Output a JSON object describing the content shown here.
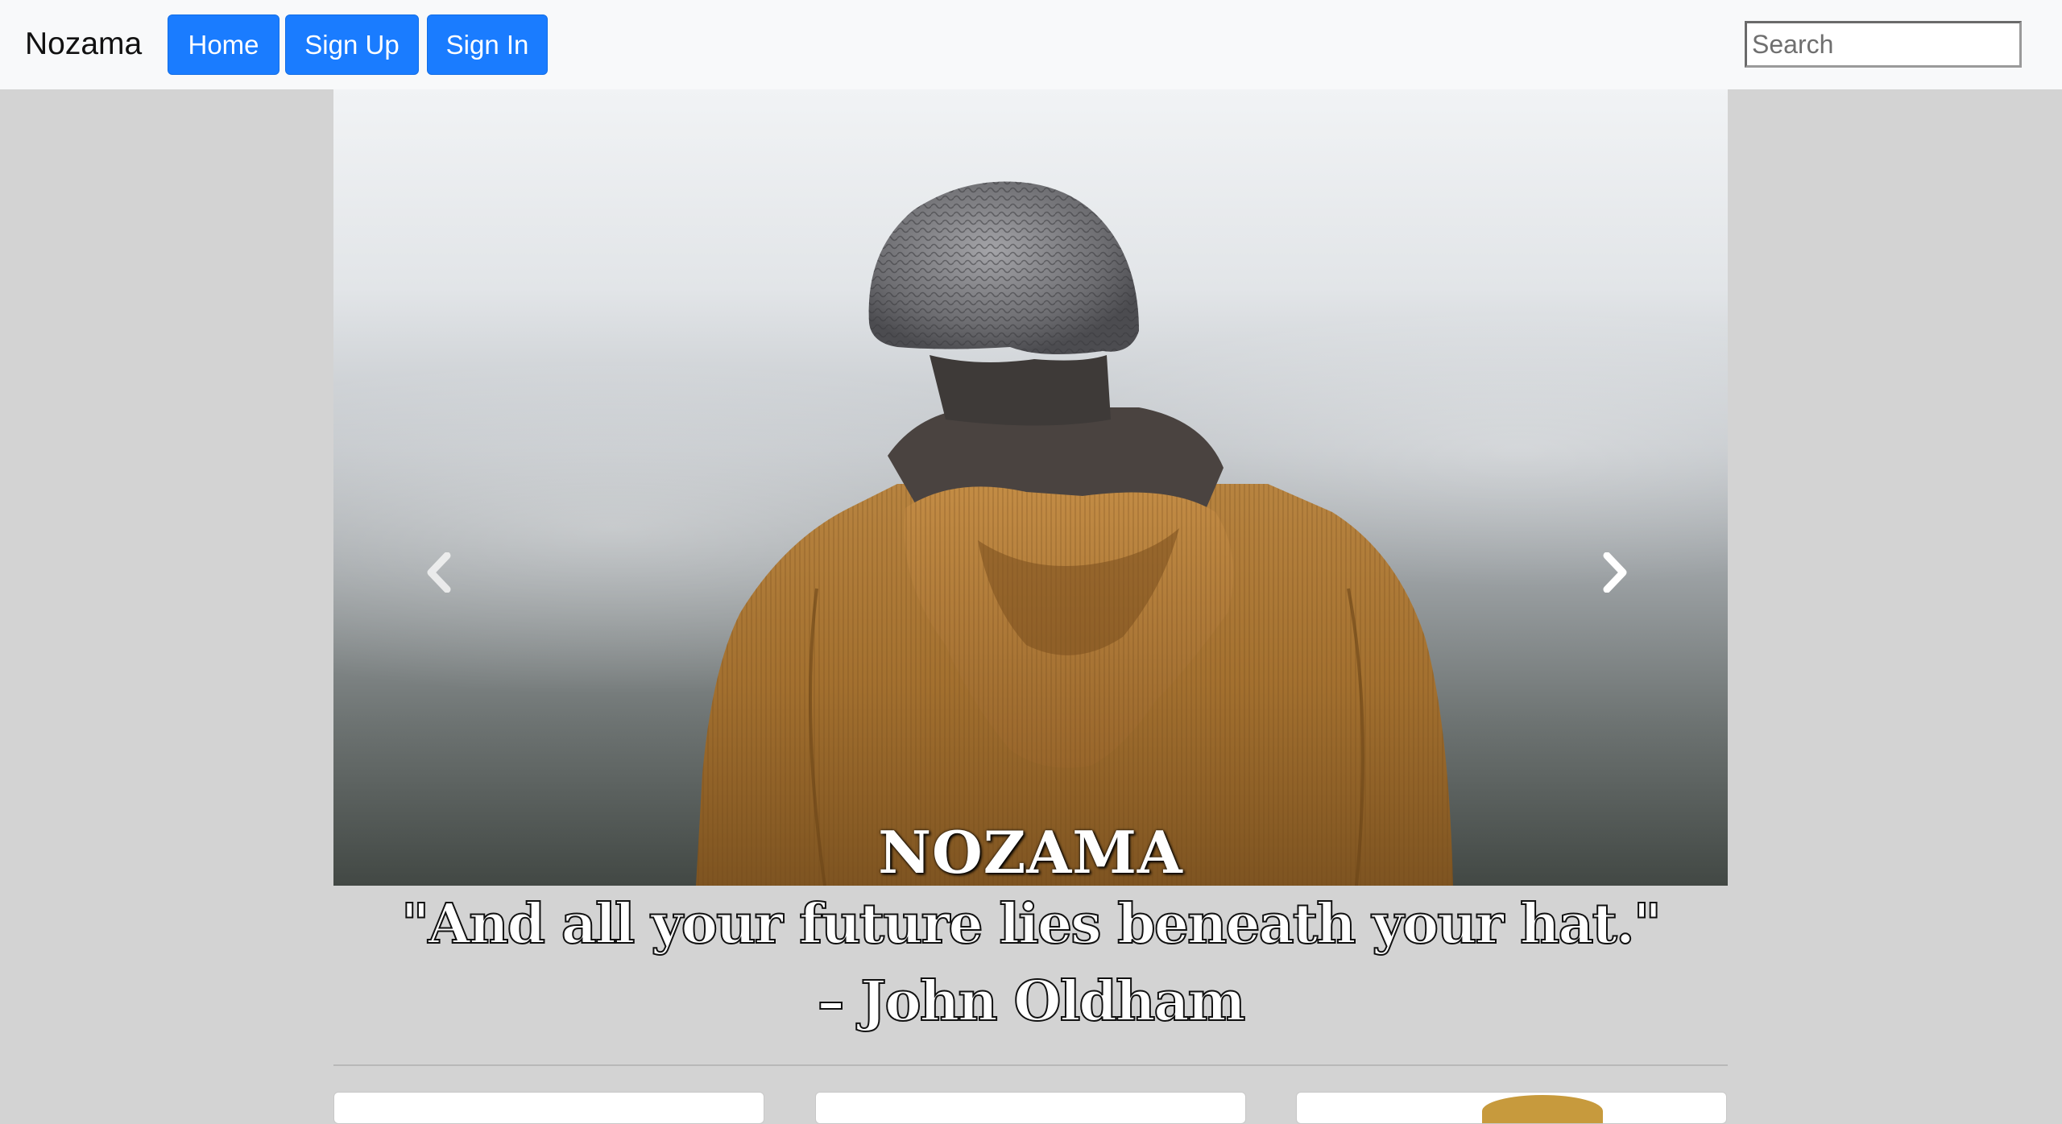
{
  "navbar": {
    "brand": "Nozama",
    "buttons": {
      "home": "Home",
      "signup": "Sign Up",
      "signin": "Sign In"
    },
    "search": {
      "placeholder": "Search"
    }
  },
  "carousel": {
    "caption": "NOZAMA",
    "prev_icon": "chevron-left-icon",
    "next_icon": "chevron-right-icon"
  },
  "quote": {
    "text": "\"And all your future lies beneath your hat.\"",
    "author": "– John Oldham"
  },
  "colors": {
    "page_background": "#d3d3d3",
    "navbar_background": "#f8f9fa",
    "button_primary": "#1a7cff"
  }
}
